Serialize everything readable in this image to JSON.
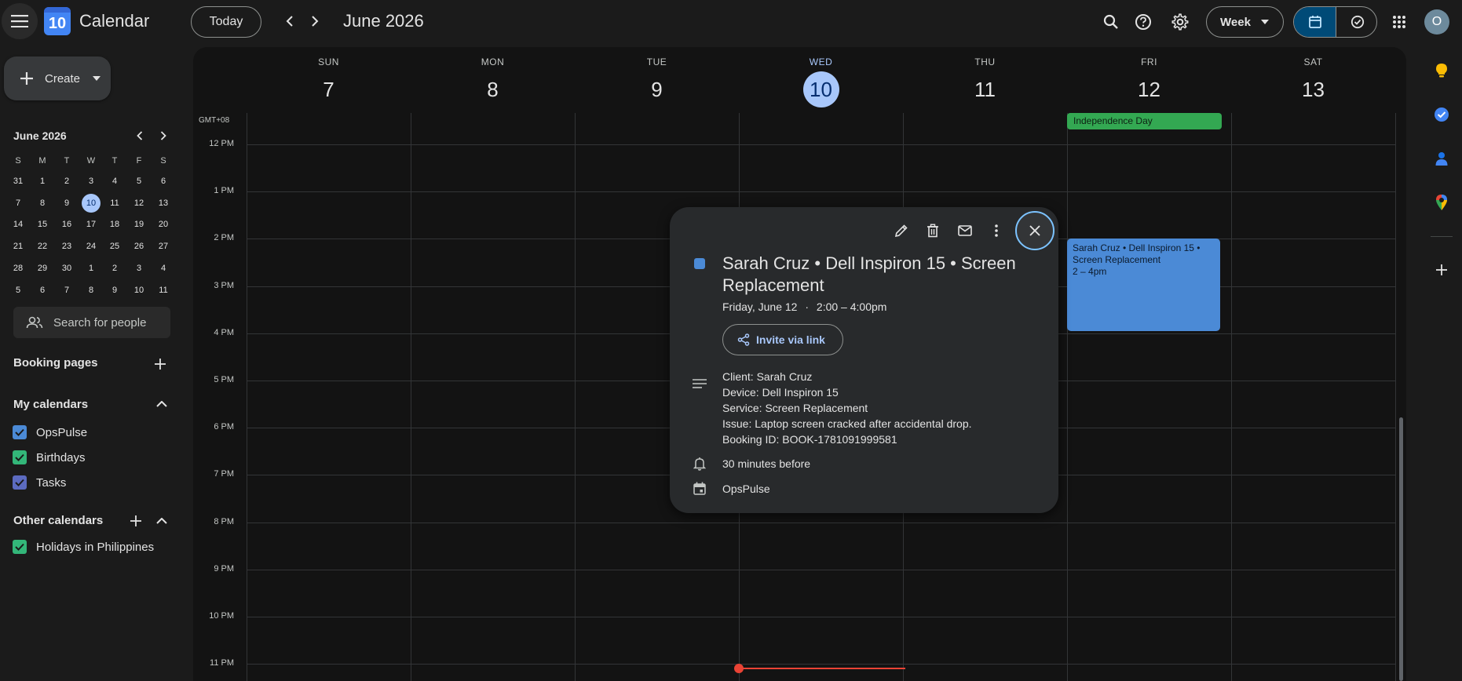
{
  "app": {
    "title": "Calendar",
    "logo_day": "10",
    "today_label": "Today",
    "current_period": "June 2026",
    "view_selector": "Week",
    "avatar_letter": "O"
  },
  "sidebar": {
    "create_label": "Create",
    "mini_calendar": {
      "title": "June 2026",
      "weekday_headers": [
        "S",
        "M",
        "T",
        "W",
        "T",
        "F",
        "S"
      ],
      "weeks": [
        [
          "31",
          "1",
          "2",
          "3",
          "4",
          "5",
          "6"
        ],
        [
          "7",
          "8",
          "9",
          "10",
          "11",
          "12",
          "13"
        ],
        [
          "14",
          "15",
          "16",
          "17",
          "18",
          "19",
          "20"
        ],
        [
          "21",
          "22",
          "23",
          "24",
          "25",
          "26",
          "27"
        ],
        [
          "28",
          "29",
          "30",
          "1",
          "2",
          "3",
          "4"
        ],
        [
          "5",
          "6",
          "7",
          "8",
          "9",
          "10",
          "11"
        ]
      ],
      "today": "10"
    },
    "search_people_placeholder": "Search for people",
    "booking_pages_label": "Booking pages",
    "my_calendars_label": "My calendars",
    "my_calendars": [
      {
        "name": "OpsPulse",
        "color": "#4b8ad6"
      },
      {
        "name": "Birthdays",
        "color": "#33b679"
      },
      {
        "name": "Tasks",
        "color": "#5c6bc0"
      }
    ],
    "other_calendars_label": "Other calendars",
    "other_calendars": [
      {
        "name": "Holidays in Philippines",
        "color": "#33b679"
      }
    ]
  },
  "week": {
    "timezone": "GMT+08",
    "days": [
      {
        "dow": "SUN",
        "num": "7"
      },
      {
        "dow": "MON",
        "num": "8"
      },
      {
        "dow": "TUE",
        "num": "9"
      },
      {
        "dow": "WED",
        "num": "10"
      },
      {
        "dow": "THU",
        "num": "11"
      },
      {
        "dow": "FRI",
        "num": "12"
      },
      {
        "dow": "SAT",
        "num": "13"
      }
    ],
    "hours": [
      "12 PM",
      "1 PM",
      "2 PM",
      "3 PM",
      "4 PM",
      "5 PM",
      "6 PM",
      "7 PM",
      "8 PM",
      "9 PM",
      "10 PM",
      "11 PM"
    ],
    "all_day_event": "Independence Day",
    "event": {
      "title": "Sarah Cruz • Dell Inspiron 15 • Screen Replacement",
      "time": "2 – 4pm"
    }
  },
  "popup": {
    "title": "Sarah Cruz • Dell Inspiron 15 • Screen Replacement",
    "date": "Friday, June 12",
    "time": "2:00 – 4:00pm",
    "invite_label": "Invite via link",
    "description": [
      "Client: Sarah Cruz",
      "Device: Dell Inspiron 15",
      "Service: Screen Replacement",
      "Issue: Laptop screen cracked after accidental drop.",
      "Booking ID: BOOK-1781091999581"
    ],
    "reminder": "30 minutes before",
    "calendar": "OpsPulse",
    "event_color": "#4b8ad6"
  }
}
